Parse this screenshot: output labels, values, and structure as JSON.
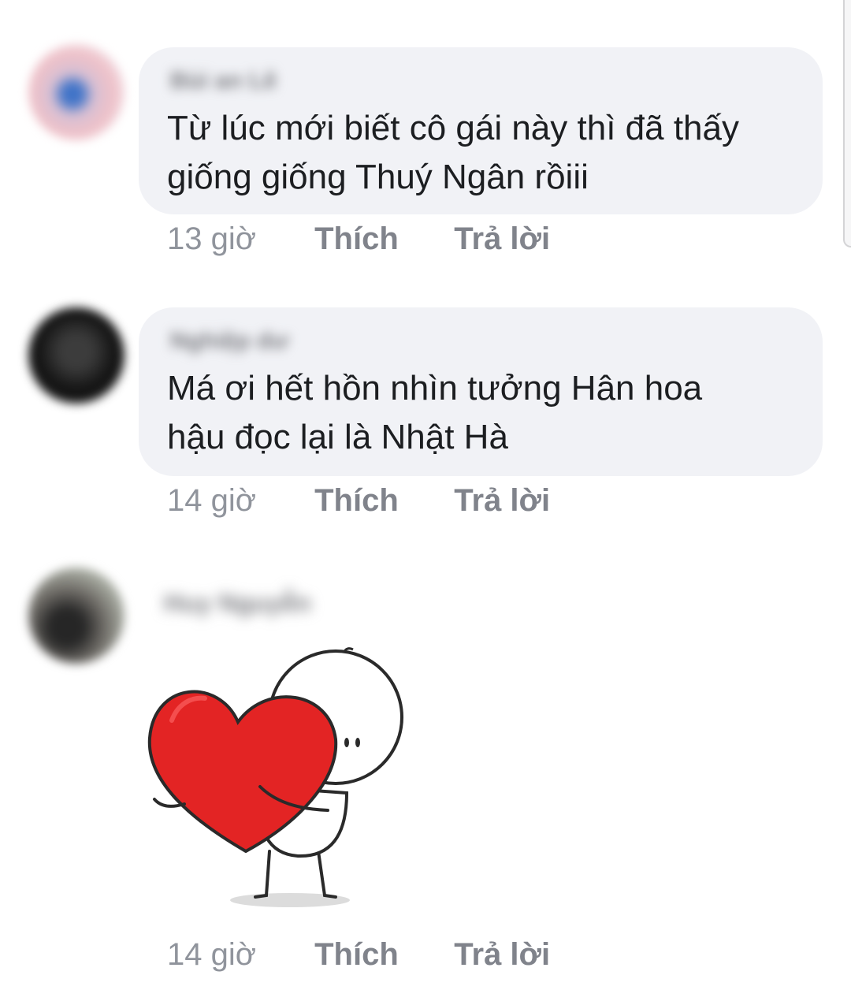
{
  "comments": [
    {
      "author": "Bùi an Lê",
      "text_line1": "Từ lúc mới biết cô gái này thì đã thấy",
      "text_line2": "giống giống Thuý Ngân rồiii",
      "time": "13 giờ",
      "like_label": "Thích",
      "reply_label": "Trả lời"
    },
    {
      "author": "Nghiệp dư",
      "text_line1": "Má ơi hết hồn nhìn tưởng Hân hoa",
      "text_line2": "hậu đọc lại là Nhật Hà",
      "time": "14 giờ",
      "like_label": "Thích",
      "reply_label": "Trả lời"
    },
    {
      "author": "Huy Nguyễn",
      "sticker": "heart-hug-sticker",
      "time": "14 giờ",
      "like_label": "Thích",
      "reply_label": "Trả lời"
    }
  ],
  "colors": {
    "bubble": "#f1f2f6",
    "text": "#1c1e21",
    "meta": "#90949c",
    "heart": "#e32424"
  }
}
